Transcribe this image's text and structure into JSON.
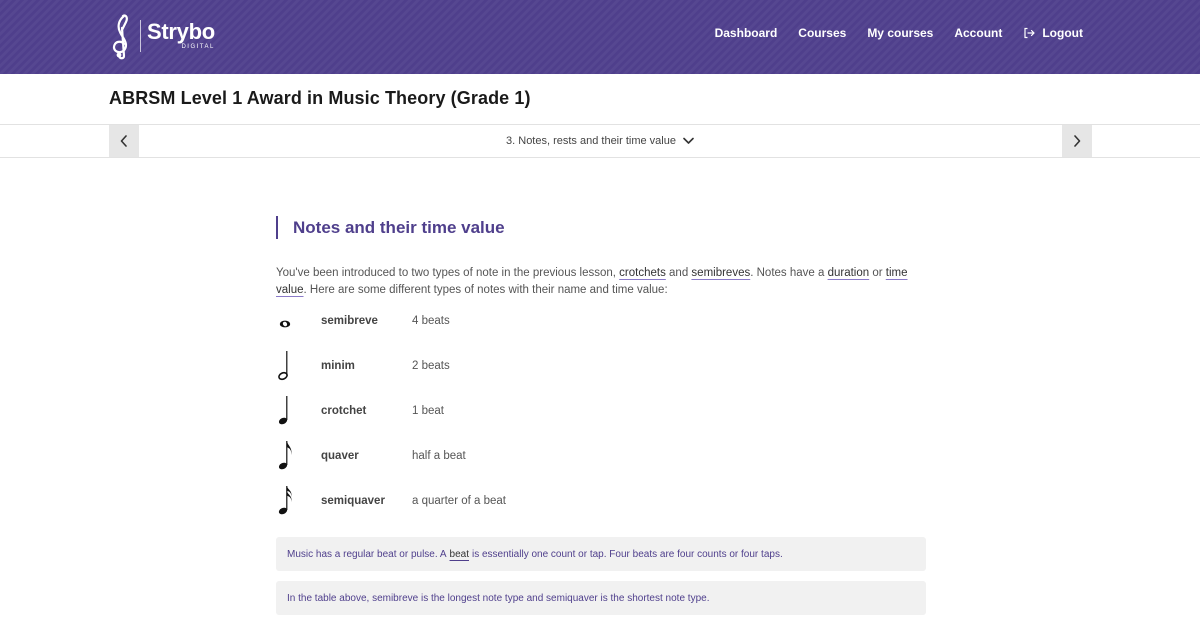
{
  "brand": {
    "name": "Strybo",
    "sub": "DIGITAL"
  },
  "nav": {
    "items": [
      "Dashboard",
      "Courses",
      "My courses",
      "Account"
    ],
    "logout": "Logout",
    "logout_icon": "logout-icon"
  },
  "course": {
    "title": "ABRSM Level 1 Award in Music Theory (Grade 1)"
  },
  "lesson": {
    "current": "3. Notes, rests and their time value"
  },
  "section": {
    "heading": "Notes and their time value",
    "intro": [
      "You've been introduced to two types of note in the previous lesson, ",
      "crotchets",
      " and ",
      "semibreves",
      ". Notes have a ",
      "duration",
      " or ",
      "time value",
      ". Here are some different types of notes with their name and time value:"
    ]
  },
  "notes": [
    {
      "icon": "semibreve-icon",
      "name": "semibreve",
      "value": "4 beats"
    },
    {
      "icon": "minim-icon",
      "name": "minim",
      "value": "2 beats"
    },
    {
      "icon": "crotchet-icon",
      "name": "crotchet",
      "value": "1 beat"
    },
    {
      "icon": "quaver-icon",
      "name": "quaver",
      "value": "half a beat"
    },
    {
      "icon": "semiquaver-icon",
      "name": "semiquaver",
      "value": "a quarter of a beat"
    }
  ],
  "callouts": {
    "beat": {
      "before": "Music has a regular beat or pulse. A",
      "term": "beat",
      "after": "is essentially one count or tap. Four beats are four counts or four taps."
    },
    "table": "In the table above, semibreve is the longest note type and semiquaver is the shortest note type."
  },
  "colors": {
    "brand": "#4f3f8c",
    "pager": "#e6e6e6",
    "callout": "#f1f1f1"
  }
}
